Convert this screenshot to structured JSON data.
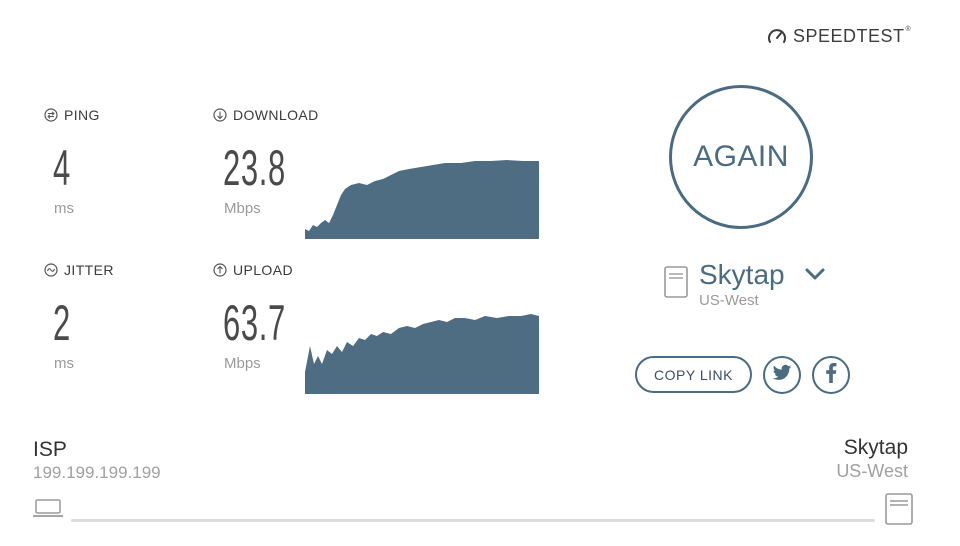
{
  "brand": {
    "name": "SPEEDTEST",
    "tm": "®",
    "icon": "speedometer-icon"
  },
  "metrics": {
    "ping": {
      "label": "PING",
      "value": "4",
      "unit": "ms",
      "icon": "ping-icon"
    },
    "jitter": {
      "label": "JITTER",
      "value": "2",
      "unit": "ms",
      "icon": "jitter-icon"
    },
    "download": {
      "label": "DOWNLOAD",
      "value": "23.8",
      "unit": "Mbps",
      "icon": "download-arrow-icon"
    },
    "upload": {
      "label": "UPLOAD",
      "value": "63.7",
      "unit": "Mbps",
      "icon": "upload-arrow-icon"
    }
  },
  "again_button": {
    "label": "AGAIN"
  },
  "server": {
    "name": "Skytap",
    "location": "US-West",
    "icon": "server-icon"
  },
  "share": {
    "copy_link": "COPY LINK",
    "twitter_icon": "twitter-icon",
    "facebook_icon": "facebook-icon"
  },
  "connection": {
    "isp_label": "ISP",
    "isp_ip": "199.199.199.199",
    "server_name": "Skytap",
    "server_location": "US-West"
  },
  "colors": {
    "accent": "#4a6b82",
    "graph_fill": "#4f6d82",
    "muted": "#9a9a9a"
  }
}
